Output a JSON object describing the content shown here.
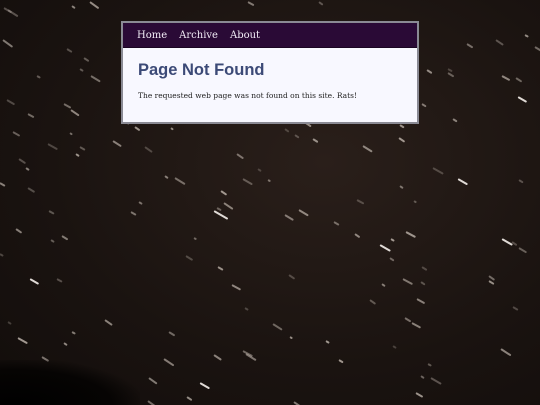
{
  "nav": {
    "items": [
      {
        "label": "Home"
      },
      {
        "label": "Archive"
      },
      {
        "label": "About"
      }
    ]
  },
  "main": {
    "title": "Page Not Found",
    "message": "The requested web page was not found on this site. Rats!"
  },
  "colors": {
    "nav_background": "#2a0a36",
    "title": "#3c4a77",
    "panel_background": "#f8f8ff",
    "sky_background": "#1c1512"
  }
}
